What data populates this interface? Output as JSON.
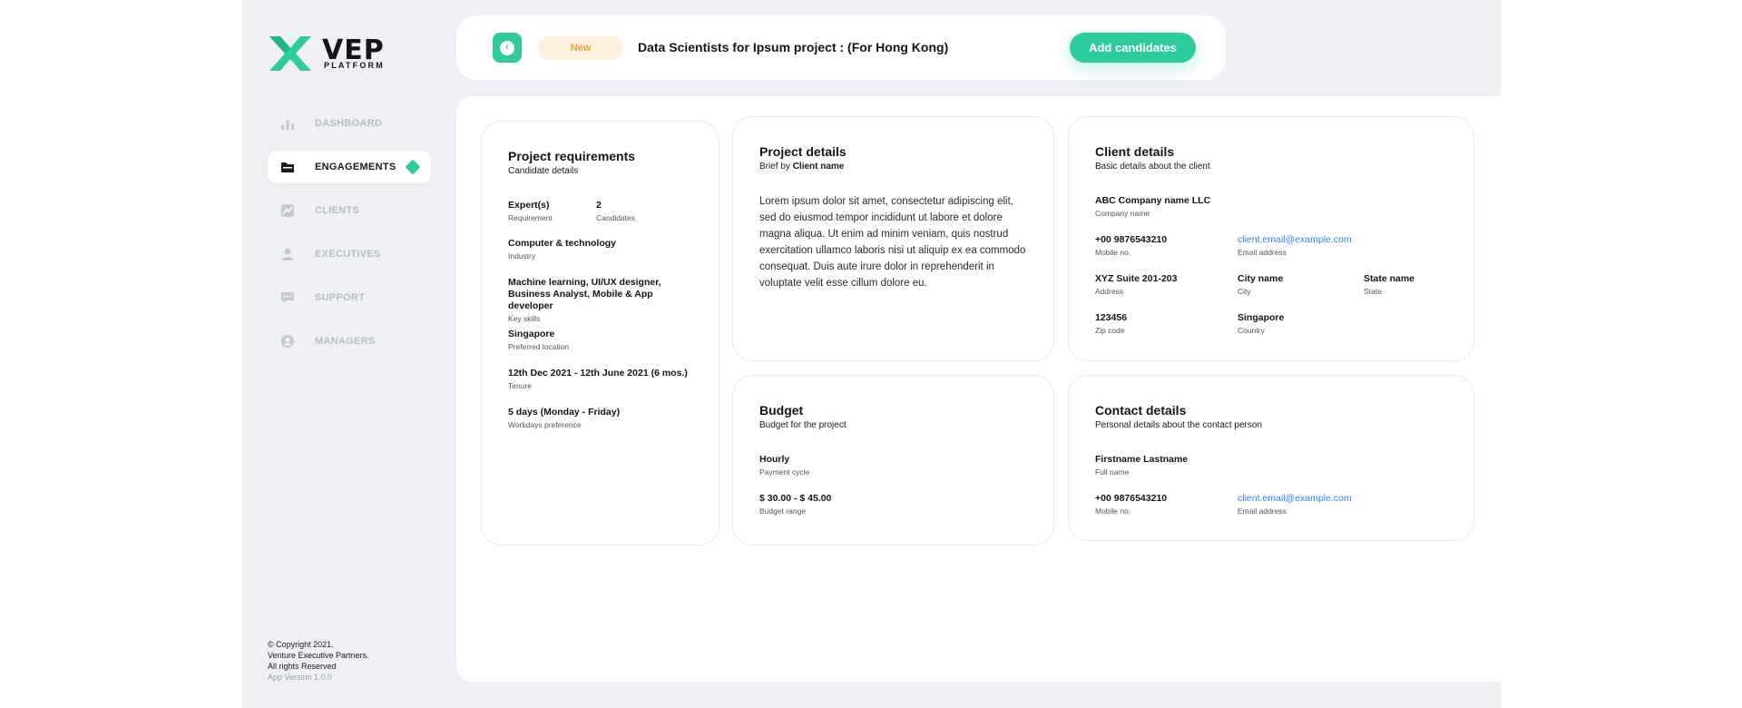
{
  "brand": {
    "name": "VEP",
    "subtitle": "PLATFORM",
    "accent": "#2ecb9e"
  },
  "sidebar": {
    "items": [
      {
        "label": "DASHBOARD",
        "icon": "chart-bars-icon",
        "active": false
      },
      {
        "label": "ENGAGEMENTS",
        "icon": "folder-icon",
        "active": true
      },
      {
        "label": "CLIENTS",
        "icon": "chart-line-icon",
        "active": false
      },
      {
        "label": "EXECUTIVES",
        "icon": "person-icon",
        "active": false
      },
      {
        "label": "SUPPORT",
        "icon": "chat-bubble-icon",
        "active": false
      },
      {
        "label": "MANAGERS",
        "icon": "user-circle-icon",
        "active": false
      }
    ],
    "footer": {
      "copyright": "© Copyright 2021.",
      "company": "Venture Executive Partners.",
      "rights": "All rights Reserved",
      "version": "App Version 1.0.0"
    }
  },
  "header": {
    "status_badge": "New",
    "title": "Data Scientists for Ipsum project : (For Hong Kong)",
    "add_button": "Add candidates"
  },
  "project_requirements": {
    "title": "Project requirements",
    "subtitle": "Candidate details",
    "experts_value": "Expert(s)",
    "experts_label": "Requirement",
    "candidates_value": "2",
    "candidates_label": "Candidates",
    "industry_value": "Computer & technology",
    "industry_label": "Industry",
    "skills_value": "Machine learning, UI/UX designer, Business Analyst, Mobile & App developer",
    "skills_label": "Key skills",
    "location_value": "Singapore",
    "location_label": "Preferred location",
    "tenure_value": "12th Dec 2021 - 12th June 2021 (6 mos.)",
    "tenure_label": "Tenure",
    "workdays_value": "5 days (Monday - Friday)",
    "workdays_label": "Workdays preference"
  },
  "project_details": {
    "title": "Project details",
    "brief_prefix": "Brief by",
    "brief_name": "Client name",
    "body": "Lorem ipsum dolor sit amet, consectetur adipiscing elit, sed do eiusmod tempor incididunt ut labore et dolore magna aliqua. Ut enim ad minim veniam, quis nostrud exercitation ullamco laboris nisi ut aliquip ex ea commodo consequat.  Duis aute irure dolor in reprehenderit in voluptate velit esse cillum dolore eu."
  },
  "client_details": {
    "title": "Client details",
    "subtitle": "Basic details about the client",
    "company_value": "ABC Company name LLC",
    "company_label": "Company name",
    "mobile_value": "+00 9876543210",
    "mobile_label": "Mobile no.",
    "email_value": "client.email@example.com",
    "email_label": "Email address",
    "address_value": "XYZ Suite 201-203",
    "address_label": "Address",
    "city_value": "City name",
    "city_label": "City",
    "state_value": "State name",
    "state_label": "State",
    "zip_value": "123456",
    "zip_label": "Zip code",
    "country_value": "Singapore",
    "country_label": "Country"
  },
  "budget": {
    "title": "Budget",
    "subtitle": "Budget for the project",
    "cycle_value": "Hourly",
    "cycle_label": "Payment cycle",
    "range_value": "$ 30.00 - $ 45.00",
    "range_label": "Budget range"
  },
  "contact_details": {
    "title": "Contact details",
    "subtitle": "Personal details about the contact person",
    "name_value": "Firstname Lastname",
    "name_label": "Full name",
    "mobile_value": "+00 9876543210",
    "mobile_label": "Mobile no.",
    "email_value": "client.email@example.com",
    "email_label": "Email address"
  }
}
